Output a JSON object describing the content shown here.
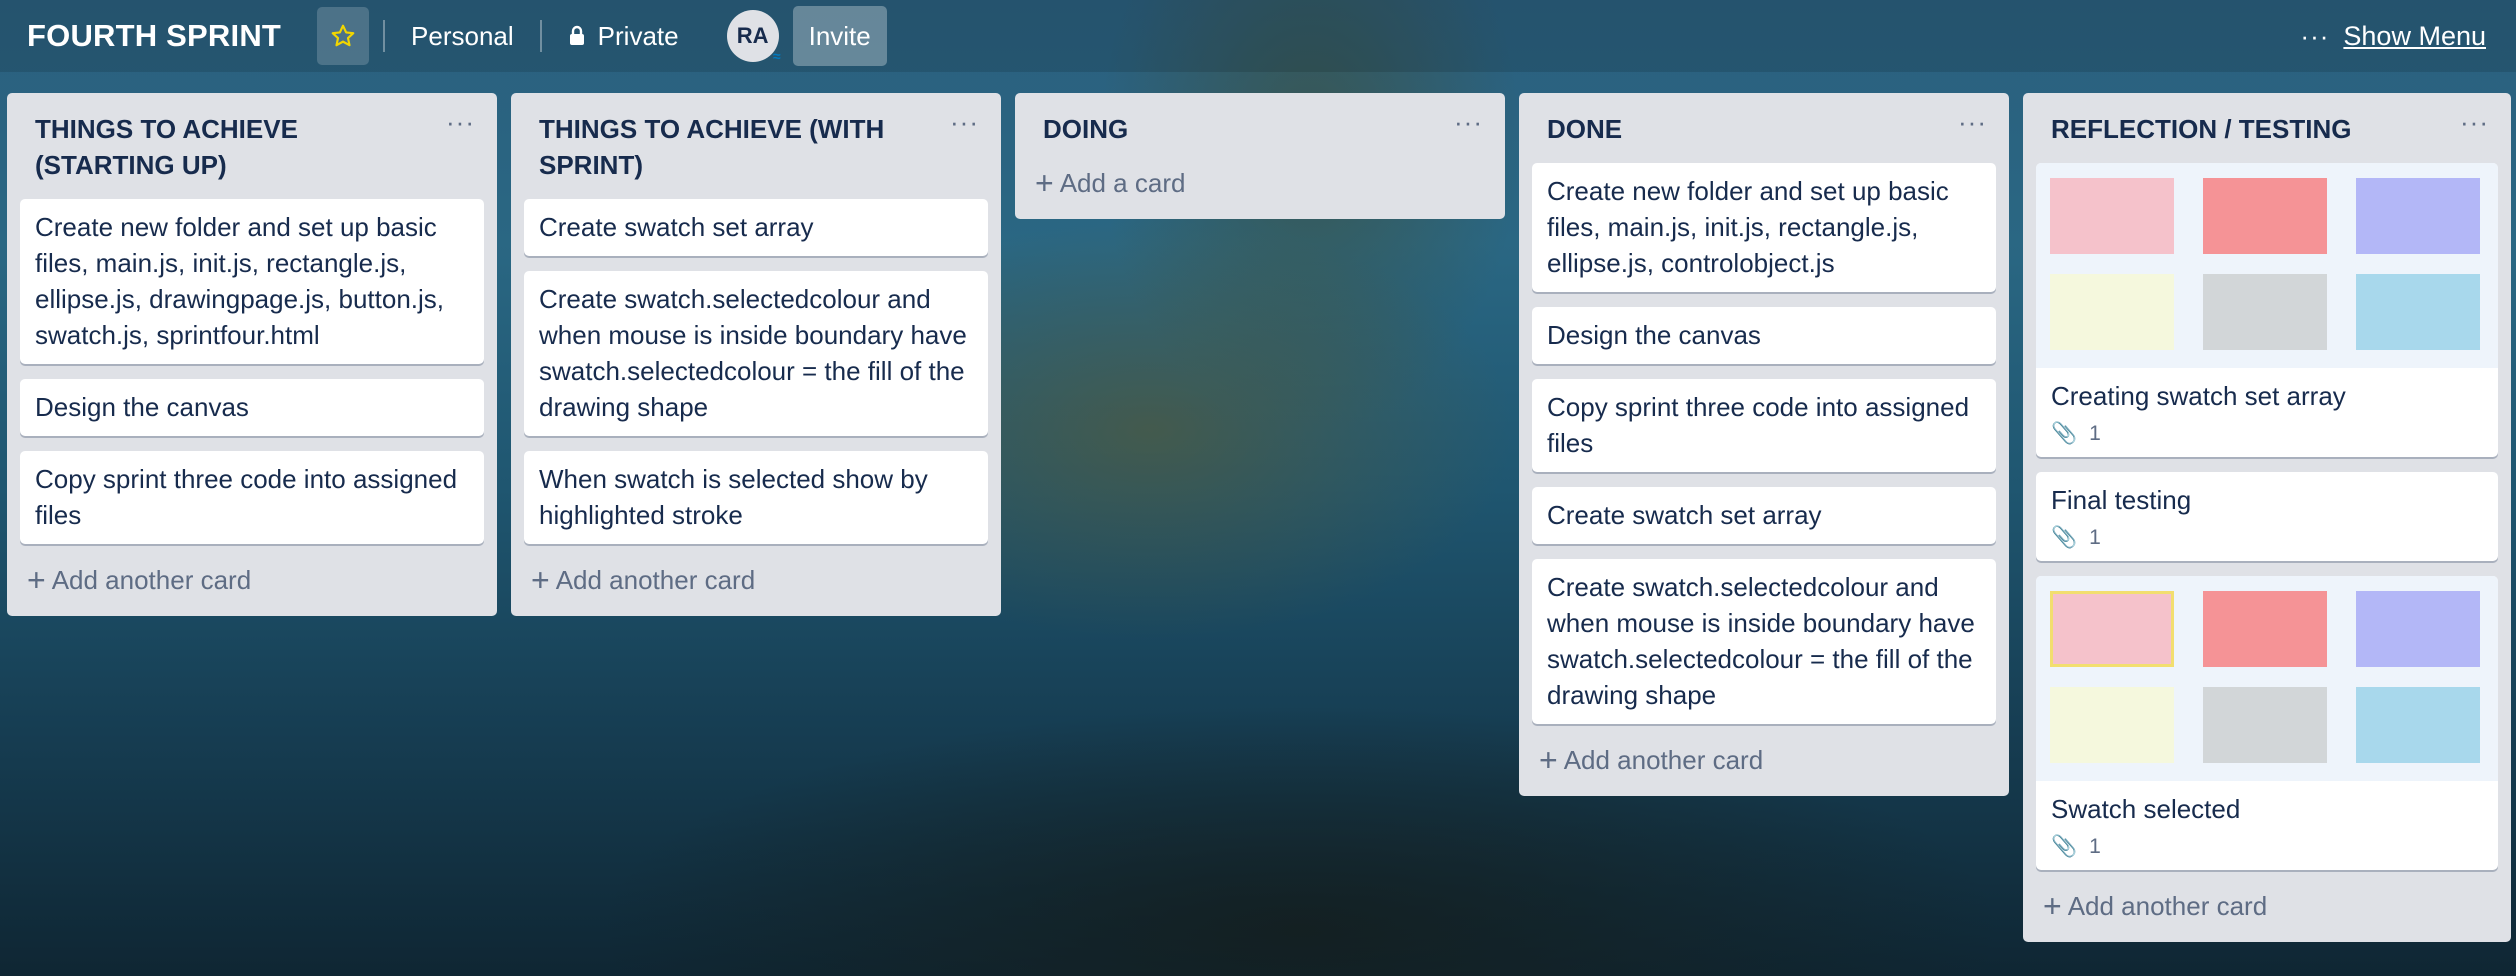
{
  "header": {
    "board_title": "FOURTH SPRINT",
    "personal_label": "Personal",
    "private_label": "Private",
    "avatar_initials": "RA",
    "invite_label": "Invite",
    "menu_dots": "···",
    "show_menu_label": "Show Menu"
  },
  "lists": [
    {
      "title": "THINGS TO ACHIEVE (STARTING UP)",
      "menu": "···",
      "cards": [
        "Create new folder and set up basic files, main.js, init.js, rectangle.js, ellipse.js, drawingpage.js, button.js, swatch.js, sprintfour.html",
        "Design the canvas",
        "Copy sprint three code into assigned files"
      ],
      "add_label": "Add another card"
    },
    {
      "title": "THINGS TO ACHIEVE (WITH SPRINT)",
      "menu": "···",
      "cards": [
        "Create swatch set array",
        "Create swatch.selectedcolour and when mouse is inside boundary have swatch.selectedcolour = the fill of the drawing shape",
        "When swatch is selected show by highlighted stroke"
      ],
      "add_label": "Add another card"
    },
    {
      "title": "DOING",
      "menu": "···",
      "cards": [],
      "add_label": "Add a card"
    },
    {
      "title": "DONE",
      "menu": "···",
      "cards": [
        "Create new folder and set up basic files, main.js, init.js, rectangle.js, ellipse.js, controlobject.js",
        "Design the canvas",
        "Copy sprint three code into assigned files",
        "Create swatch set array",
        "Create swatch.selectedcolour and when mouse is inside boundary have swatch.selectedcolour = the fill of the drawing shape"
      ],
      "add_label": "Add another card"
    },
    {
      "title": "REFLECTION / TESTING",
      "menu": "···",
      "cards": [
        {
          "title": "Creating swatch set array",
          "attachments": "1"
        },
        {
          "title": "Final testing",
          "attachments": "1"
        },
        {
          "title": "Swatch selected",
          "attachments": "1"
        }
      ],
      "add_label": "Add another card"
    }
  ],
  "swatch_colors": [
    "#f5c2cb",
    "#f59396",
    "#b3b7f7",
    "#f5f8dd",
    "#d2d6d8",
    "#a8d8ec"
  ],
  "colors": {
    "list_bg": "#dfe1e6",
    "card_bg": "#ffffff",
    "text": "#172b4d",
    "muted": "#5e6c84",
    "star": "#f2d600"
  }
}
